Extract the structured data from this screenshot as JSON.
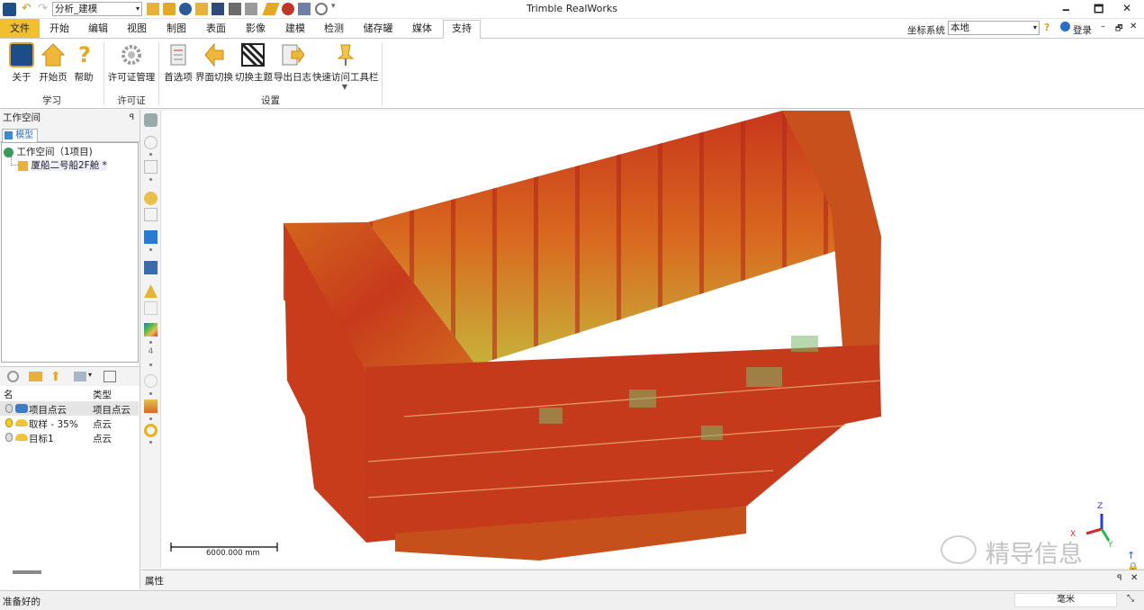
{
  "window": {
    "title": "Trimble RealWorks",
    "minimize": "🗕",
    "maximize": "🗖",
    "close": "✕"
  },
  "quick_access": {
    "combo_value": "分析_建模"
  },
  "menu_tabs": [
    "文件",
    "开始",
    "编辑",
    "视图",
    "制图",
    "表面",
    "影像",
    "建模",
    "检测",
    "储存罐",
    "媒体",
    "支持"
  ],
  "active_tab": "支持",
  "coord": {
    "label": "坐标系统",
    "value": "本地",
    "help": "?",
    "login": "登录"
  },
  "ribbon": {
    "groups": [
      {
        "label": "学习",
        "buttons": [
          "关于",
          "开始页",
          "帮助"
        ]
      },
      {
        "label": "许可证",
        "buttons": [
          "许可证管理"
        ]
      },
      {
        "label": "设置",
        "buttons": [
          "首选项",
          "界面切换",
          "切换主题",
          "导出日志",
          "快速访问工具栏"
        ]
      }
    ]
  },
  "workspace": {
    "title": "工作空间",
    "pin": "ꟼ",
    "tab": "模型",
    "root": "工作空间（1项目)",
    "project": "厦船二号船2F舱 *"
  },
  "list": {
    "col_name": "名",
    "col_type": "类型",
    "rows": [
      {
        "name": "项目点云",
        "type": "项目点云"
      },
      {
        "name": "取样 - 35%",
        "type": "点云"
      },
      {
        "name": "目标1",
        "type": "点云"
      }
    ]
  },
  "viewport": {
    "scale_label": "6000.000 mm",
    "axis": {
      "z": "Z",
      "x": "X",
      "y": "Y"
    },
    "watermark": "精导信息"
  },
  "properties": {
    "title": "属性"
  },
  "status": {
    "text": "准备好的",
    "unit": "毫米"
  },
  "colors": {
    "file_tab": "#f0c030",
    "accent": "#2b6cc4",
    "cloud_red": "#c8361c",
    "cloud_orange": "#d9691f",
    "cloud_yellow": "#c7b23a"
  }
}
